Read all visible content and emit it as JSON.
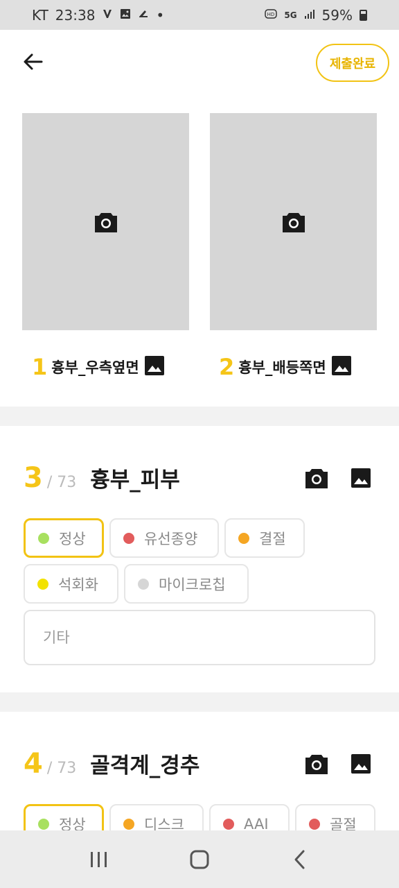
{
  "status_bar": {
    "carrier": "KT",
    "time": "23:38",
    "dot": "•",
    "network": "5G",
    "battery": "59%"
  },
  "header": {
    "back_icon": "arrow-left-icon",
    "submit_label": "제출완료",
    "accent_color": "#F5C518"
  },
  "photos": [
    {
      "number": "1",
      "label": "흉부_우측옆면"
    },
    {
      "number": "2",
      "label": "흉부_배등쪽면"
    }
  ],
  "sections": [
    {
      "number": "3",
      "total": "/ 73",
      "title": "흉부_피부",
      "options": [
        {
          "label": "정상",
          "color": "#A8E05F",
          "selected": true
        },
        {
          "label": "유선종양",
          "color": "#E25C5C",
          "selected": false
        },
        {
          "label": "결절",
          "color": "#F5A623",
          "selected": false
        },
        {
          "label": "석회화",
          "color": "#F2E200",
          "selected": false
        },
        {
          "label": "마이크로칩",
          "color": "#D6D6D6",
          "selected": false
        }
      ],
      "etc_placeholder": "기타"
    },
    {
      "number": "4",
      "total": "/ 73",
      "title": "골격계_경추",
      "options": [
        {
          "label": "정상",
          "color": "#A8E05F",
          "selected": true
        },
        {
          "label": "디스크",
          "color": "#F5A623",
          "selected": false
        },
        {
          "label": "AAI",
          "color": "#E25C5C",
          "selected": false
        },
        {
          "label": "골절",
          "color": "#E25C5C",
          "selected": false
        }
      ]
    }
  ]
}
